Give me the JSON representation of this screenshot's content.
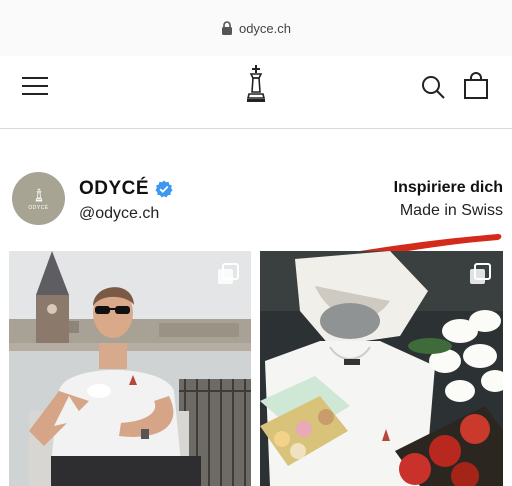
{
  "browser": {
    "url": "odyce.ch"
  },
  "header": {
    "menu_icon": "hamburger-icon",
    "logo_icon": "chess-king-icon",
    "search_icon": "search-icon",
    "cart_icon": "shopping-bag-icon"
  },
  "profile": {
    "name": "ODYCÉ",
    "handle": "@odyce.ch",
    "avatar_text": "ODYCÉ",
    "verified_icon": "verified-badge-icon",
    "tagline": "Inspiriere dich",
    "subline": "Made in Swiss"
  },
  "colors": {
    "accent_red": "#d42a1c",
    "verified_blue": "#3d97f0",
    "avatar_bg": "#a7a494"
  },
  "gallery": {
    "posts": [
      {
        "multi_icon": "carousel-icon"
      },
      {
        "multi_icon": "carousel-icon"
      }
    ]
  }
}
